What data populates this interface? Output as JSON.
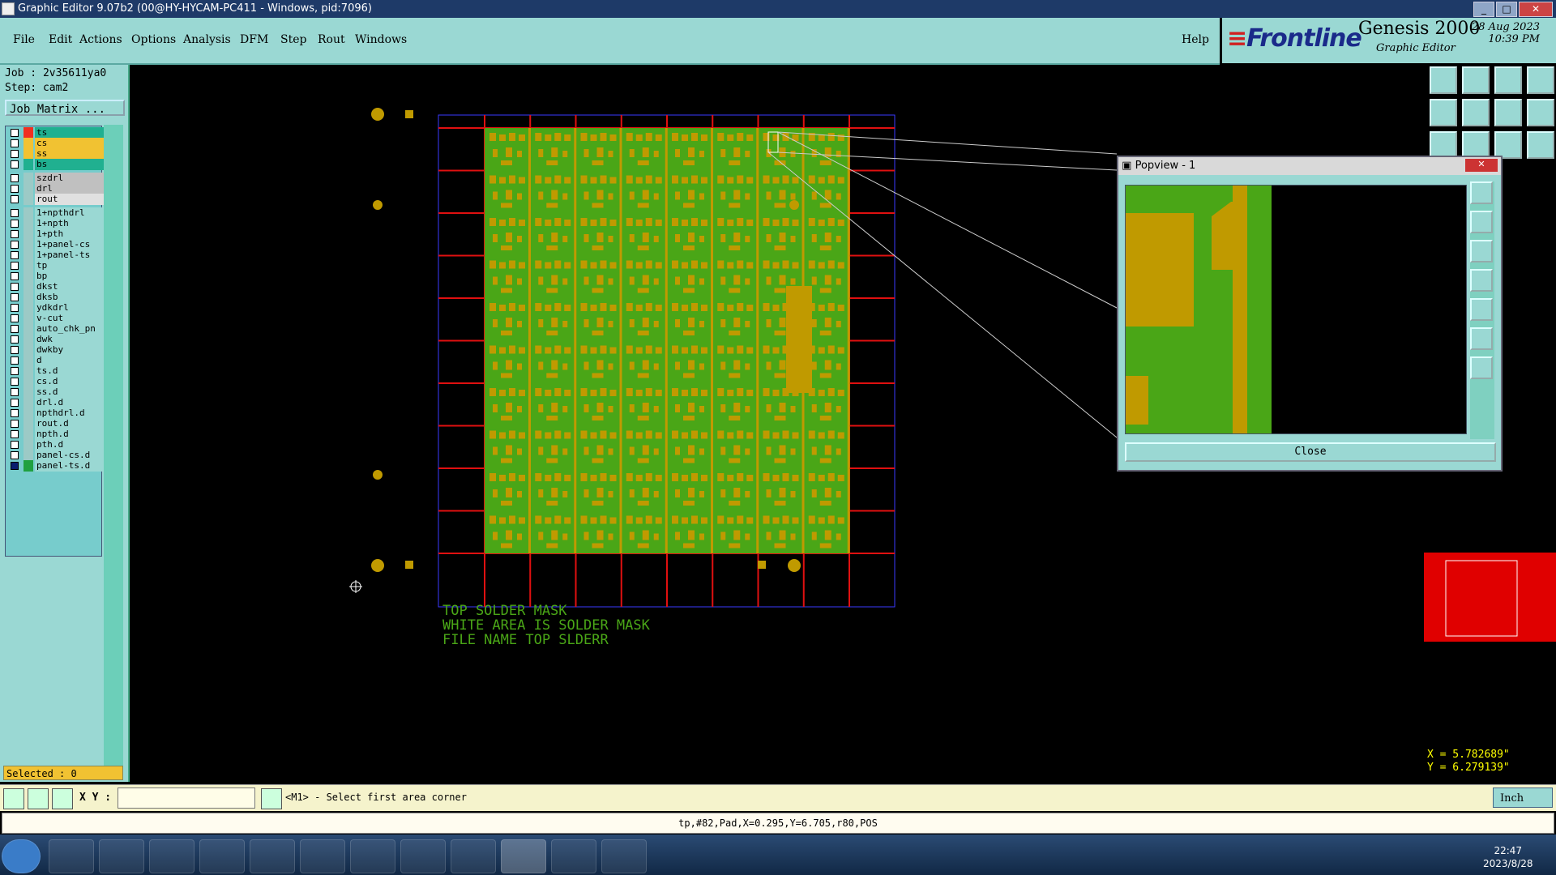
{
  "window": {
    "title": "Graphic Editor 9.07b2 (00@HY-HYCAM-PC411 - Windows, pid:7096)"
  },
  "menu": {
    "items": [
      "File",
      "Edit",
      "Actions",
      "Options",
      "Analysis",
      "DFM",
      "Step",
      "Rout",
      "Windows"
    ],
    "help": "Help"
  },
  "brand": {
    "logo": "Frontline",
    "product": "Genesis 2000",
    "subtitle": "Graphic Editor",
    "date": "28 Aug 2023",
    "time": "10:39 PM"
  },
  "job": {
    "job_label": "Job : 2v35611ya0",
    "step_label": "Step: cam2",
    "matrix_button": "Job Matrix ..."
  },
  "layers": [
    {
      "name": "ts",
      "color": "#f03020",
      "bg": "#20b090",
      "on": false
    },
    {
      "name": "cs",
      "color": "#f1c232",
      "bg": "#f1c232",
      "on": false
    },
    {
      "name": "ss",
      "color": "#f1c232",
      "bg": "#f1c232",
      "on": false
    },
    {
      "name": "bs",
      "color": "#20b090",
      "bg": "#20b090",
      "on": false
    },
    {
      "name": "szdrl",
      "color": "#9ccac6",
      "bg": "#c0c0c0",
      "on": false
    },
    {
      "name": "drl",
      "color": "#9ccac6",
      "bg": "#c0c0c0",
      "on": false
    },
    {
      "name": "rout",
      "color": "#9ccac6",
      "bg": "#e0e0e0",
      "on": false
    },
    {
      "name": "1+npthdrl",
      "color": "#9ccac6",
      "bg": "#9ad8d3",
      "on": false
    },
    {
      "name": "1+npth",
      "color": "#9ccac6",
      "bg": "#9ad8d3",
      "on": false
    },
    {
      "name": "1+pth",
      "color": "#9ccac6",
      "bg": "#9ad8d3",
      "on": false
    },
    {
      "name": "1+panel-cs",
      "color": "#9ccac6",
      "bg": "#9ad8d3",
      "on": false
    },
    {
      "name": "1+panel-ts",
      "color": "#9ccac6",
      "bg": "#9ad8d3",
      "on": false
    },
    {
      "name": "tp",
      "color": "#9ccac6",
      "bg": "#9ad8d3",
      "on": false
    },
    {
      "name": "bp",
      "color": "#9ccac6",
      "bg": "#9ad8d3",
      "on": false
    },
    {
      "name": "dkst",
      "color": "#9ccac6",
      "bg": "#9ad8d3",
      "on": false
    },
    {
      "name": "dksb",
      "color": "#9ccac6",
      "bg": "#9ad8d3",
      "on": false
    },
    {
      "name": "ydkdrl",
      "color": "#9ccac6",
      "bg": "#9ad8d3",
      "on": false
    },
    {
      "name": "v-cut",
      "color": "#9ccac6",
      "bg": "#9ad8d3",
      "on": false
    },
    {
      "name": "auto_chk_pn",
      "color": "#9ccac6",
      "bg": "#9ad8d3",
      "on": false
    },
    {
      "name": "dwk",
      "color": "#9ccac6",
      "bg": "#9ad8d3",
      "on": false
    },
    {
      "name": "dwkby",
      "color": "#9ccac6",
      "bg": "#9ad8d3",
      "on": false
    },
    {
      "name": "d",
      "color": "#9ccac6",
      "bg": "#9ad8d3",
      "on": false
    },
    {
      "name": "ts.d",
      "color": "#9ccac6",
      "bg": "#9ad8d3",
      "on": false
    },
    {
      "name": "cs.d",
      "color": "#9ccac6",
      "bg": "#9ad8d3",
      "on": false
    },
    {
      "name": "ss.d",
      "color": "#9ccac6",
      "bg": "#9ad8d3",
      "on": false
    },
    {
      "name": "drl.d",
      "color": "#9ccac6",
      "bg": "#9ad8d3",
      "on": false
    },
    {
      "name": "npthdrl.d",
      "color": "#9ccac6",
      "bg": "#9ad8d3",
      "on": false
    },
    {
      "name": "rout.d",
      "color": "#9ccac6",
      "bg": "#9ad8d3",
      "on": false
    },
    {
      "name": "npth.d",
      "color": "#9ccac6",
      "bg": "#9ad8d3",
      "on": false
    },
    {
      "name": "pth.d",
      "color": "#9ccac6",
      "bg": "#9ad8d3",
      "on": false
    },
    {
      "name": "panel-cs.d",
      "color": "#9ccac6",
      "bg": "#9ad8d3",
      "on": false
    },
    {
      "name": "panel-ts.d",
      "color": "#20a040",
      "bg": "#9ad8d3",
      "on": true
    }
  ],
  "selected": "Selected : 0",
  "canvas": {
    "text_lines": [
      "TOP SOLDER MASK",
      "WHITE AREA IS SOLDER MASK",
      "FILE NAME TOP SLDERR"
    ],
    "colors": {
      "board": "#4aa617",
      "pads": "#c09a00",
      "grid": "#e01010",
      "outline": "#3a3aff"
    }
  },
  "popview": {
    "title": "Popview - 1",
    "close": "Close"
  },
  "coords": {
    "x": "X = 5.782689\"",
    "y": "Y = 6.279139\""
  },
  "command": {
    "xy_label": "X Y :",
    "prompt": "<M1> - Select first area corner",
    "unit": "Inch"
  },
  "status": "tp,#82,Pad,X=0.295,Y=6.705,r80,POS",
  "taskbar": {
    "time": "22:47",
    "date": "2023/8/28"
  }
}
